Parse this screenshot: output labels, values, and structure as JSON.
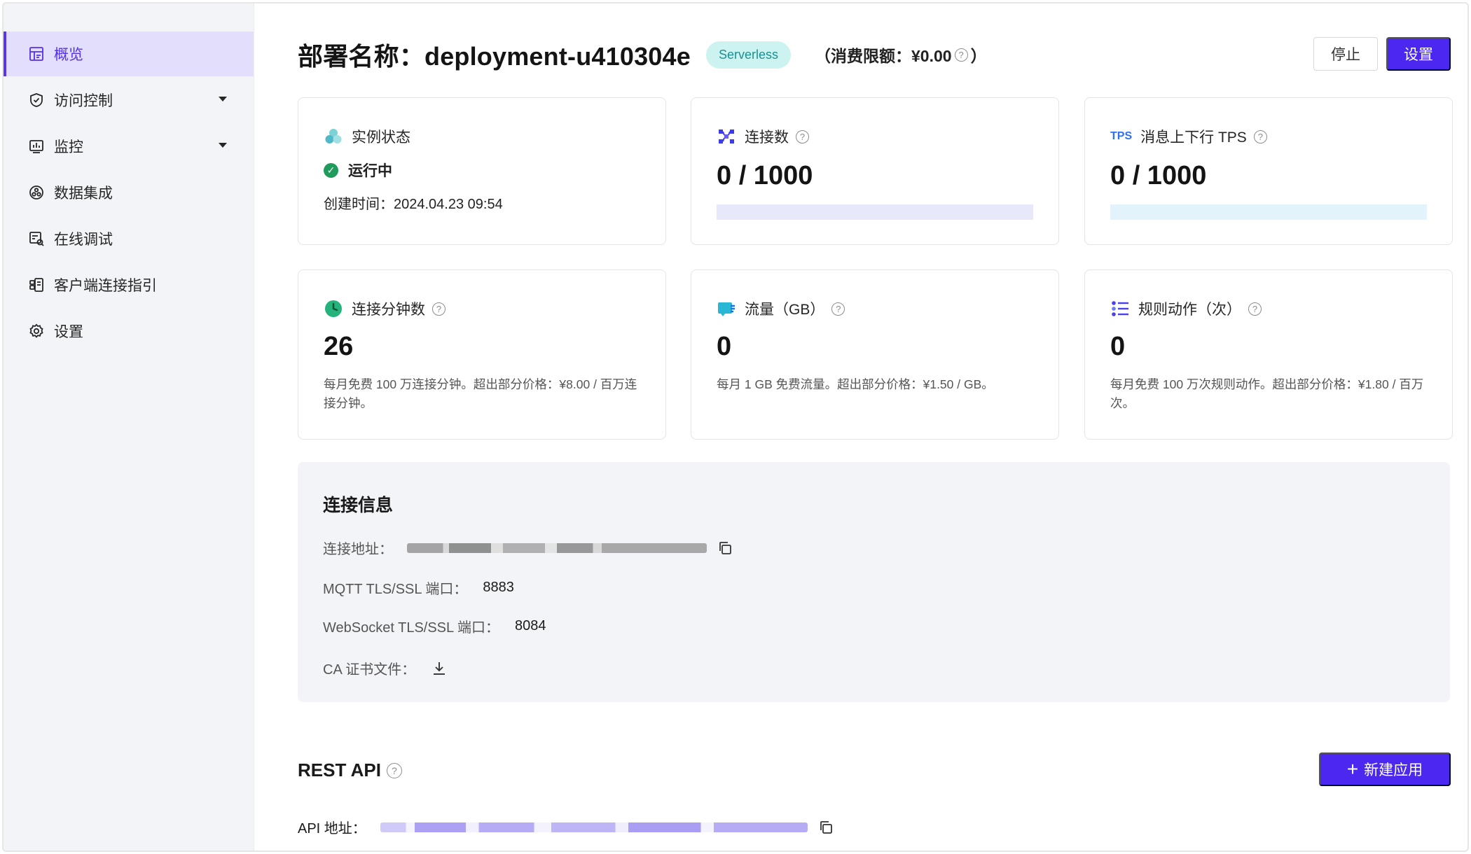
{
  "sidebar": {
    "items": [
      {
        "label": "概览",
        "icon": "dashboard-icon",
        "active": true
      },
      {
        "label": "访问控制",
        "icon": "shield-icon",
        "expandable": true
      },
      {
        "label": "监控",
        "icon": "monitor-chart-icon",
        "expandable": true
      },
      {
        "label": "数据集成",
        "icon": "integration-icon"
      },
      {
        "label": "在线调试",
        "icon": "debug-icon"
      },
      {
        "label": "客户端连接指引",
        "icon": "client-guide-icon"
      },
      {
        "label": "设置",
        "icon": "gear-icon"
      }
    ]
  },
  "header": {
    "title": "部署名称：deployment-u410304e",
    "badge": "Serverless",
    "limit_prefix": "（消费限额：¥0.00",
    "limit_suffix": "）",
    "stop_button": "停止",
    "settings_button": "设置"
  },
  "cards": {
    "status": {
      "title": "实例状态",
      "status": "运行中",
      "created": "创建时间：2024.04.23 09:54"
    },
    "connections": {
      "title": "连接数",
      "value": "0 / 1000",
      "fill": 0
    },
    "tps": {
      "title": "消息上下行 TPS",
      "icon_text": "TPS",
      "value": "0 / 1000",
      "fill": 0
    },
    "conn_minutes": {
      "title": "连接分钟数",
      "value": "26",
      "desc": "每月免费 100 万连接分钟。超出部分价格：¥8.00 / 百万连接分钟。"
    },
    "traffic": {
      "title": "流量（GB）",
      "value": "0",
      "desc": "每月 1 GB 免费流量。超出部分价格：¥1.50 / GB。"
    },
    "rules": {
      "title": "规则动作（次）",
      "value": "0",
      "desc": "每月免费 100 万次规则动作。超出部分价格：¥1.80 / 百万次。"
    }
  },
  "connection_info": {
    "title": "连接信息",
    "address_label": "连接地址：",
    "mqtt_label": "MQTT TLS/SSL 端口：",
    "mqtt_port": "8883",
    "ws_label": "WebSocket TLS/SSL 端口：",
    "ws_port": "8084",
    "ca_label": "CA 证书文件："
  },
  "rest_api": {
    "title": "REST API",
    "new_app_button": "新建应用",
    "api_address_label": "API 地址："
  },
  "colors": {
    "primary": "#4b27f0",
    "active_bg": "#e3defc",
    "success": "#1f9b5b",
    "badge_bg": "#cdf3f1"
  }
}
